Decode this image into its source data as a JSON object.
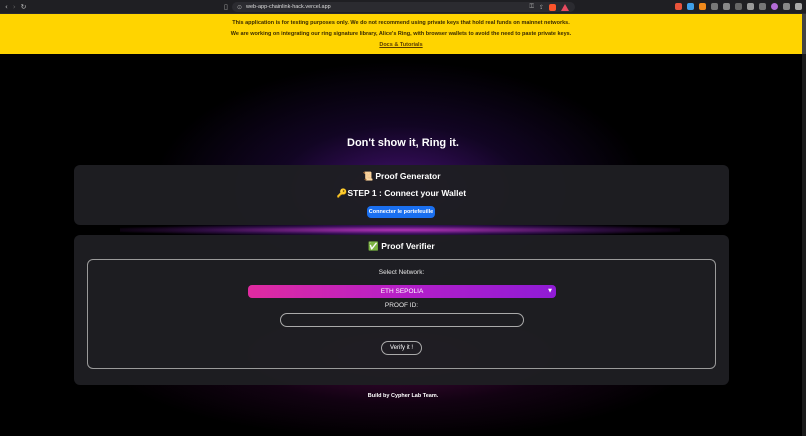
{
  "browser": {
    "url": "web-app-chainlink-hack.vercel.app",
    "back_icon": "‹",
    "forward_icon": "›",
    "reload_icon": "↻",
    "bookmark_icon": "▯",
    "lock_icon": "⊙"
  },
  "banner": {
    "line1": "This application is for testing purposes only. We do not recommend using private keys that hold real funds on mainnet networks.",
    "line2": "We are working on integrating our ring signature library, Alice's Ring, with browser wallets to avoid the need to paste private keys.",
    "link": "Docs & Tutorials",
    "color": "#ffd400"
  },
  "headline": "Don't show it, Ring it.",
  "generator": {
    "title": "📜 Proof Generator",
    "step": "🔑STEP 1 : Connect your Wallet",
    "connect_label": "Connecter le portefeuille",
    "connect_color": "#1a6ff0"
  },
  "verifier": {
    "title": "✅ Proof Verifier",
    "network_label": "Select Network:",
    "network_selected": "ETH SEPOLIA",
    "proof_id_label": "PROOF ID:",
    "proof_id_value": "",
    "verify_label": "Verify it !"
  },
  "footer": "Build by Cypher Lab Team."
}
